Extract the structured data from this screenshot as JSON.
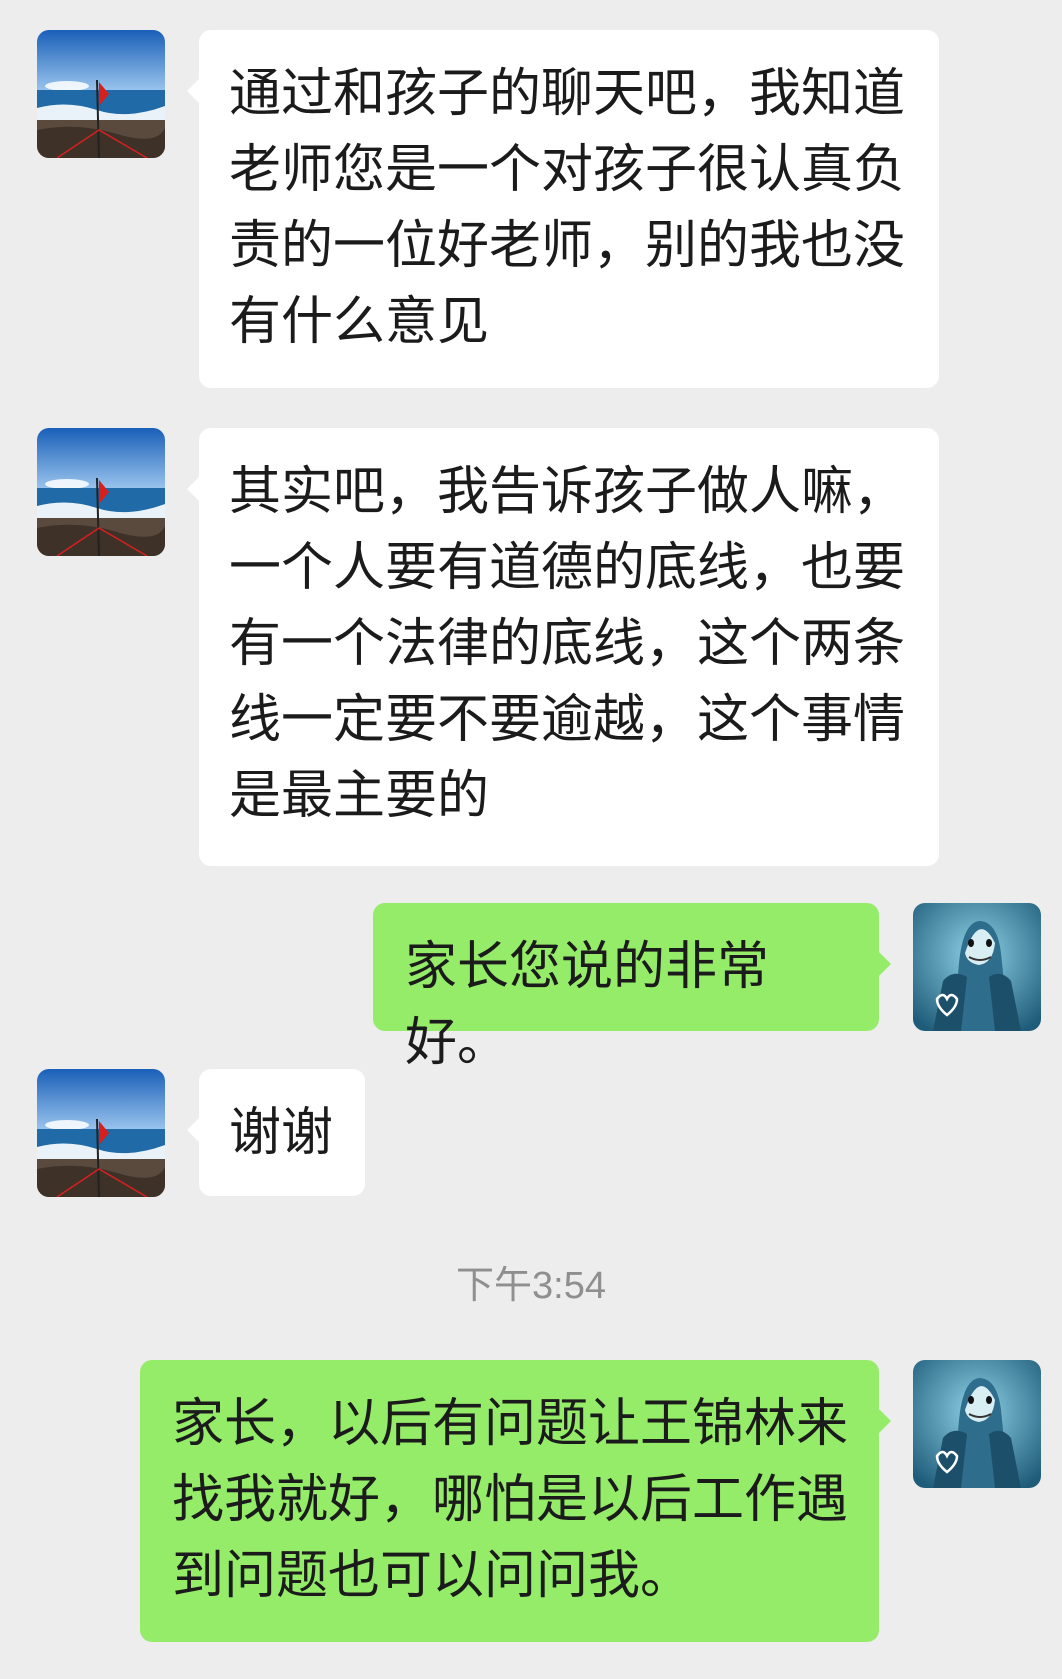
{
  "messages": [
    {
      "sender": "contact",
      "text": "通过和孩子的聊天吧，我知道老师您是一个对孩子很认真负责的一位好老师，别的我也没有什么意见"
    },
    {
      "sender": "contact",
      "text": "其实吧，我告诉孩子做人嘛，一个人要有道德的底线，也要有一个法律的底线，这个两条线一定要不要逾越，这个事情是最主要的"
    },
    {
      "sender": "me",
      "text": "家长您说的非常好。"
    },
    {
      "sender": "contact",
      "text": "谢谢"
    },
    {
      "sender": "me",
      "text": "家长，以后有问题让王锦林来找我就好，哪怕是以后工作遇到问题也可以问问我。"
    }
  ],
  "timestamp": "下午3:54",
  "avatars": {
    "contact": "seascape-with-red-flag-avatar",
    "me": "blue-dolphin-with-heart-avatar"
  },
  "colors": {
    "background": "#ededed",
    "incoming_bubble": "#ffffff",
    "outgoing_bubble": "#95ec69",
    "timestamp_text": "#8f8f8f"
  }
}
